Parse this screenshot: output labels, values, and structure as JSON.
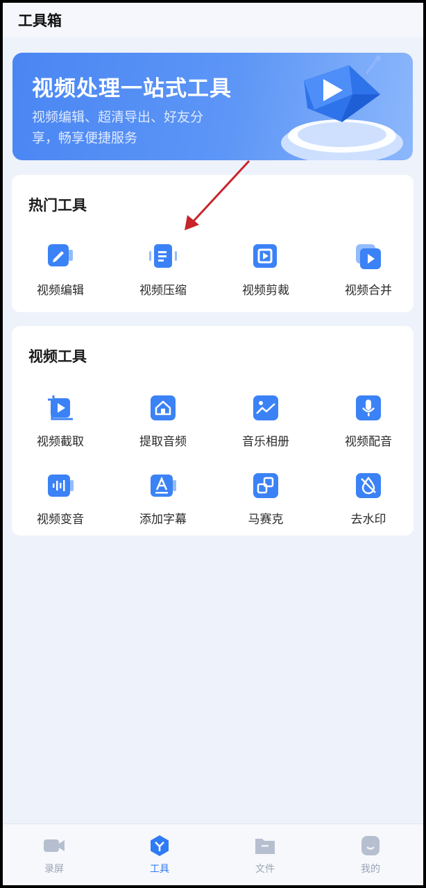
{
  "header": {
    "title": "工具箱"
  },
  "banner": {
    "title": "视频处理一站式工具",
    "subtitle_line1": "视频编辑、超清导出、好友分",
    "subtitle_line2": "享，畅享便捷服务"
  },
  "hot_tools": {
    "title": "热门工具",
    "items": [
      {
        "label": "视频编辑",
        "icon": "edit-icon"
      },
      {
        "label": "视频压缩",
        "icon": "compress-icon"
      },
      {
        "label": "视频剪裁",
        "icon": "crop-icon"
      },
      {
        "label": "视频合并",
        "icon": "merge-icon"
      }
    ]
  },
  "video_tools": {
    "title": "视频工具",
    "items": [
      {
        "label": "视频截取",
        "icon": "clip-icon"
      },
      {
        "label": "提取音频",
        "icon": "extract-audio-icon"
      },
      {
        "label": "音乐相册",
        "icon": "music-album-icon"
      },
      {
        "label": "视频配音",
        "icon": "microphone-icon"
      },
      {
        "label": "视频变音",
        "icon": "voice-change-icon"
      },
      {
        "label": "添加字幕",
        "icon": "subtitle-icon"
      },
      {
        "label": "马赛克",
        "icon": "mosaic-icon"
      },
      {
        "label": "去水印",
        "icon": "remove-watermark-icon"
      }
    ]
  },
  "bottom_nav": {
    "items": [
      {
        "label": "录屏",
        "icon": "video-camera-icon",
        "active": false
      },
      {
        "label": "工具",
        "icon": "toolbox-icon",
        "active": true
      },
      {
        "label": "文件",
        "icon": "folder-icon",
        "active": false
      },
      {
        "label": "我的",
        "icon": "profile-icon",
        "active": false
      }
    ]
  },
  "colors": {
    "accent": "#2f7bf5",
    "icon_blue": "#3b82f6",
    "annotation_arrow": "#c8242a",
    "background": "#eef2fb"
  }
}
